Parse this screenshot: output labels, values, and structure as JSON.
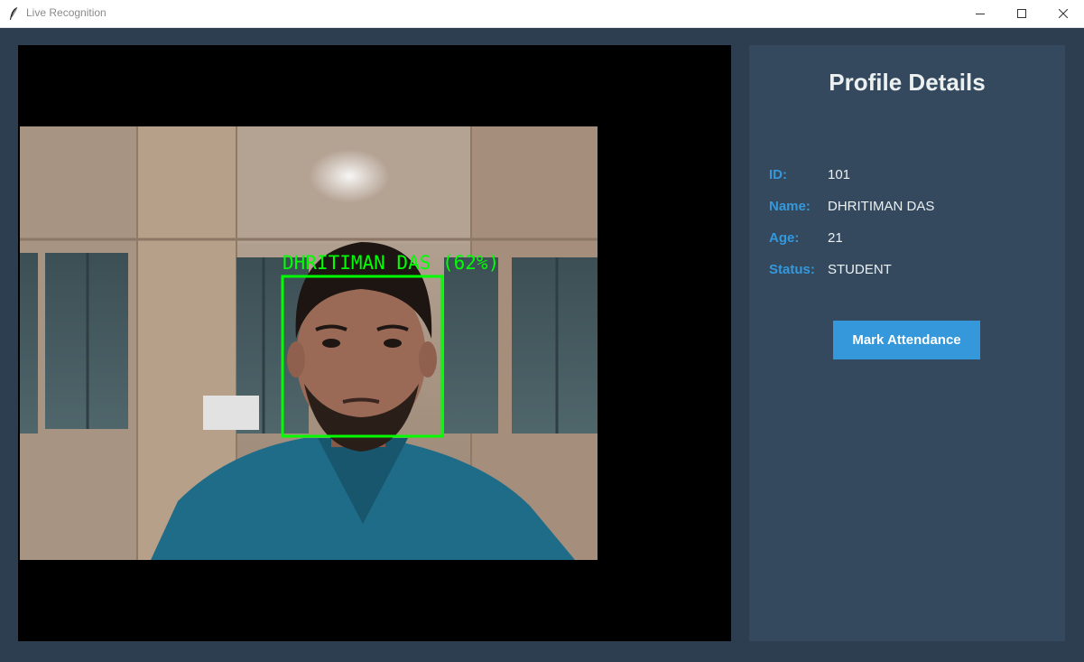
{
  "window": {
    "title": "Live Recognition",
    "controls": [
      "minimize-icon",
      "maximize-icon",
      "close-icon"
    ]
  },
  "camera": {
    "detection_label": "DHRITIMAN DAS (62%)",
    "box_color": "#00ff00"
  },
  "profile": {
    "title": "Profile Details",
    "fields": [
      {
        "label": "ID:",
        "value": "101"
      },
      {
        "label": "Name:",
        "value": "DHRITIMAN DAS"
      },
      {
        "label": "Age:",
        "value": "21"
      },
      {
        "label": "Status:",
        "value": "STUDENT"
      }
    ],
    "action_label": "Mark Attendance"
  },
  "colors": {
    "window_bg": "#2c3e50",
    "panel_bg": "#34495e",
    "accent": "#3498db",
    "text": "#ecf0f1"
  }
}
